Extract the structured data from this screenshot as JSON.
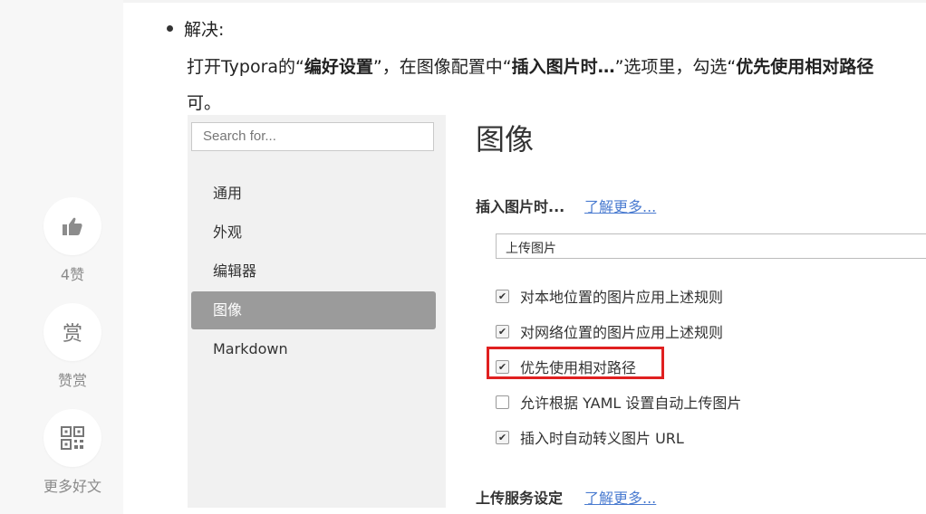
{
  "rail": {
    "like": {
      "icon": "thumbs-up-icon",
      "label": "4赞"
    },
    "reward": {
      "icon_char": "赏",
      "label": "赞赏"
    },
    "more": {
      "icon": "qr-code-icon",
      "label": "更多好文"
    }
  },
  "article": {
    "bullet_label": "解决:",
    "para": {
      "p1": "打开Typora的“",
      "b1": "编好设置",
      "p2": "”，在图像配置中“",
      "b2": "插入图片时…",
      "p3": "”选项里，勾选“",
      "b3": "优先使用相对路径"
    },
    "para_end": "可。"
  },
  "screenshot": {
    "search_placeholder": "Search for...",
    "nav": [
      "通用",
      "外观",
      "编辑器",
      "图像",
      "Markdown"
    ],
    "active_nav": "图像",
    "pane_title": "图像",
    "insert_label": "插入图片时...",
    "learn_more": "了解更多...",
    "select_value": "上传图片",
    "options": [
      {
        "label": "对本地位置的图片应用上述规则",
        "checked": true
      },
      {
        "label": "对网络位置的图片应用上述规则",
        "checked": true
      },
      {
        "label": "优先使用相对路径",
        "checked": true
      },
      {
        "label": "允许根据 YAML 设置自动上传图片",
        "checked": false
      },
      {
        "label": "插入时自动转义图片 URL",
        "checked": true
      }
    ],
    "upload_section_label": "上传服务设定",
    "upload_learn_more": "了解更多...",
    "highlight_color": "#e02020"
  }
}
